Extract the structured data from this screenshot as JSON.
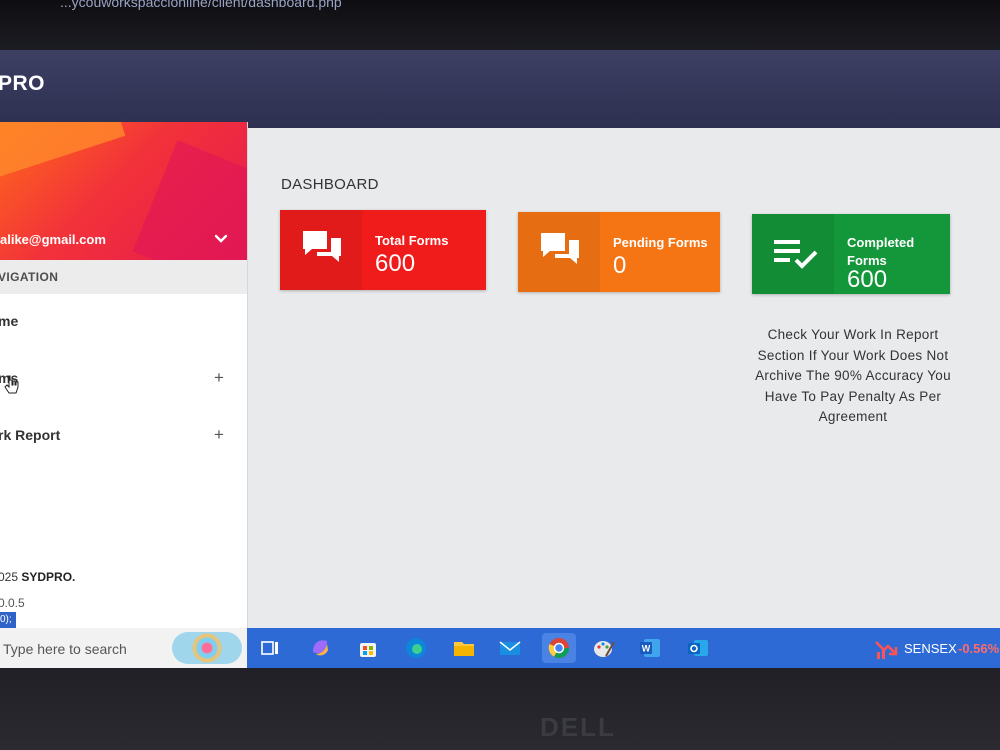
{
  "browser": {
    "url": "...ycouworkspaccionline/client/dashboard.php"
  },
  "app": {
    "brand": "PRO"
  },
  "sidebar": {
    "email": "alike@gmail.com",
    "nav_header": "VIGATION",
    "items": [
      {
        "label": "me",
        "has_expand": false
      },
      {
        "label": "ms",
        "has_expand": true,
        "expand": "+"
      },
      {
        "label": "rk Report",
        "has_expand": true,
        "expand": "+"
      }
    ],
    "footer_copy_prefix": "025 ",
    "footer_brand": "SYDPRO.",
    "footer_version": "0.0.5",
    "footer_tag": "0);"
  },
  "dashboard": {
    "title": "DASHBOARD",
    "cards": [
      {
        "title": "Total Forms",
        "value": "600",
        "color": "#f01c1c",
        "icon": "chat-icon"
      },
      {
        "title": "Pending Forms",
        "value": "0",
        "color": "#f57414",
        "icon": "chat-icon"
      },
      {
        "title": "Completed Forms",
        "value": "600",
        "color": "#14963a",
        "icon": "checklist-icon"
      }
    ],
    "notice": "Check Your Work In Report Section If Your Work Does Not Archive The 90% Accuracy You Have To Pay Penalty As Per Agreement"
  },
  "taskbar": {
    "search_placeholder": "Type here to search",
    "sensex_label": "SENSEX",
    "sensex_change": "-0.56%"
  },
  "monitor": {
    "brand": "DELL"
  }
}
